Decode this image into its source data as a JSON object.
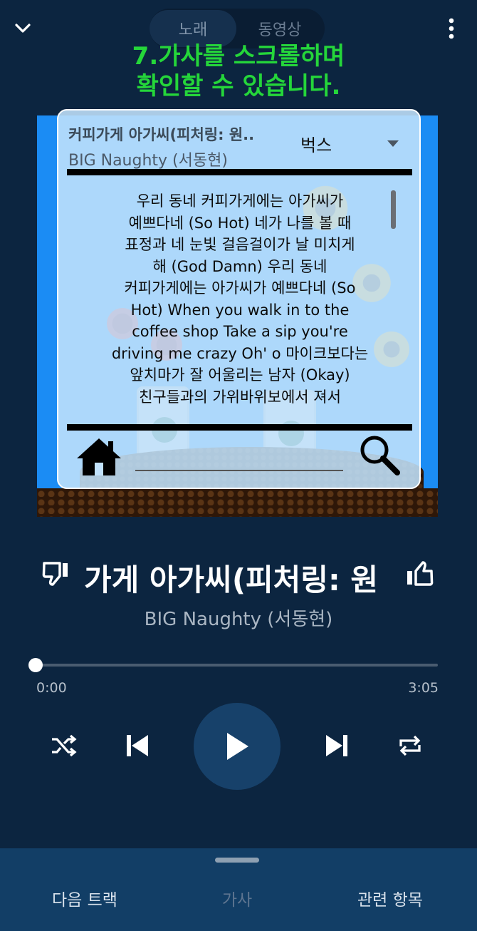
{
  "header": {
    "tabs": [
      {
        "label": "노래",
        "active": true
      },
      {
        "label": "동영상",
        "active": false
      }
    ],
    "collapse_icon": "chevron-down-icon",
    "menu_icon": "more-vert-icon"
  },
  "banner": {
    "line1": "7.가사를 스크롤하며",
    "line2": "확인할 수 있습니다.",
    "color": "#25d63a"
  },
  "lyrics_panel": {
    "title": "커피가게 아가씨(피처링: 원..",
    "artist": "BIG Naughty (서동현)",
    "source_select": "벅스",
    "lyrics": [
      "우리 동네 커피가게에는 아가씨가",
      "예쁘다네 (So Hot) 네가 나를 볼 때",
      "표정과 네 눈빛 걸음걸이가 날 미치게",
      "해 (God Damn) 우리 동네",
      "커피가게에는 아가씨가 예쁘다네 (So",
      "Hot) When you walk in to the",
      "coffee shop Take a sip you're",
      "driving me crazy Oh' o 마이크보다는",
      "앞치마가 잘 어울리는 남자 (Okay)",
      "친구들과의 가위바위보에서 져서"
    ]
  },
  "song": {
    "title": "가게 아가씨(피처링: 원",
    "artist": "BIG Naughty (서동현)"
  },
  "progress": {
    "current": "0:00",
    "total": "3:05",
    "fraction": 0.0
  },
  "bottom_tabs": [
    {
      "label": "다음 트랙",
      "active": false
    },
    {
      "label": "가사",
      "active": true
    },
    {
      "label": "관련 항목",
      "active": false
    }
  ],
  "colors": {
    "background": "#0c2540",
    "album_bg": "#1b8cf4",
    "sheet": "#123e66",
    "play_button": "#17416a"
  }
}
